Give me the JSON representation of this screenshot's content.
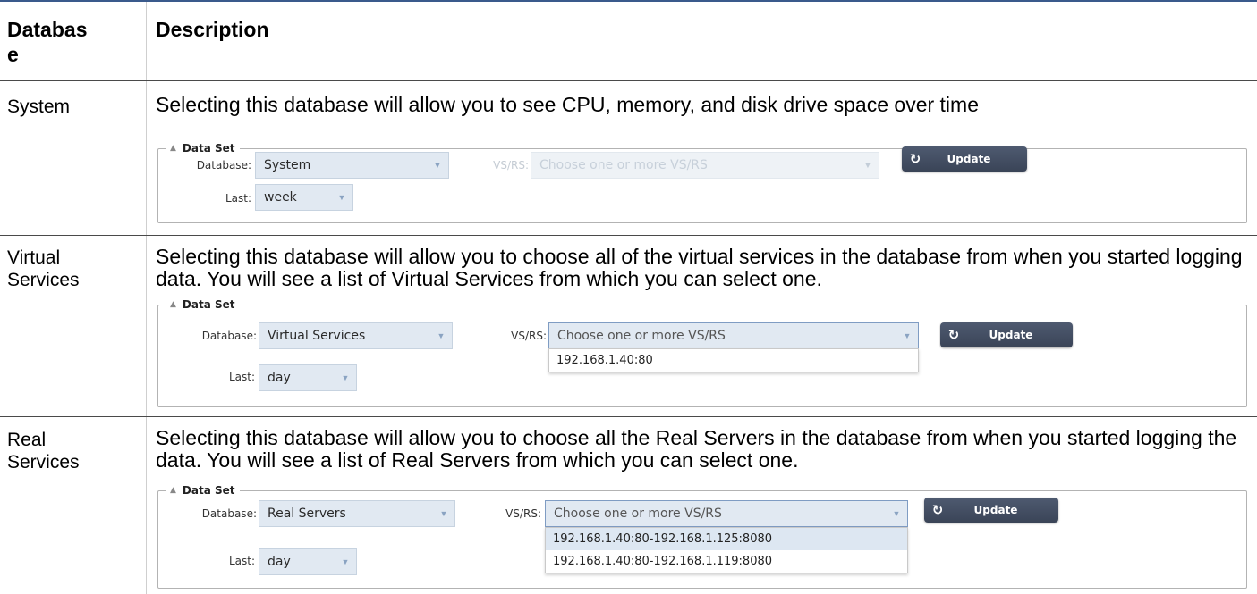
{
  "table": {
    "header_database": "Databas",
    "header_database_wrap": "e",
    "header_description": "Description"
  },
  "rows": [
    {
      "label": "System",
      "description": "Selecting this database will allow you to see CPU, memory, and disk drive space over time",
      "dataset": {
        "legend": "Data Set",
        "database_label": "Database:",
        "database_value": "System",
        "vsrs_label": "VS/RS:",
        "vsrs_placeholder": "Choose one or more VS/RS",
        "vsrs_disabled": true,
        "update_label": "Update",
        "last_label": "Last:",
        "last_value": "week"
      }
    },
    {
      "label": "Virtual Services",
      "description": "Selecting this database will allow you to choose all of the virtual services in the database from when you started logging data. You will see a list of Virtual Services from which you can select one.",
      "dataset": {
        "legend": "Data Set",
        "database_label": "Database:",
        "database_value": "Virtual Services",
        "vsrs_label": "VS/RS:",
        "vsrs_placeholder": "Choose one or more VS/RS",
        "vsrs_disabled": false,
        "update_label": "Update",
        "last_label": "Last:",
        "last_value": "day",
        "vsrs_options": [
          "192.168.1.40:80"
        ]
      }
    },
    {
      "label": "Real Services",
      "description": "Selecting this database will allow you to choose all the Real Servers in the database from when you started logging the data. You will see a list of Real Servers from which you can select one.",
      "dataset": {
        "legend": "Data Set",
        "database_label": "Database:",
        "database_value": "Real Servers",
        "vsrs_label": "VS/RS:",
        "vsrs_placeholder": "Choose one or more VS/RS",
        "vsrs_disabled": false,
        "update_label": "Update",
        "last_label": "Last:",
        "last_value": "day",
        "vsrs_options": [
          "192.168.1.40:80-192.168.1.125:8080",
          "192.168.1.40:80-192.168.1.119:8080"
        ]
      }
    }
  ],
  "icons": {
    "update": "refresh-icon",
    "dropdown": "chevron-down-icon",
    "collapse": "triangle-up-icon"
  },
  "colors": {
    "button": "#434d62",
    "select_bg": "#e1e9f2",
    "highlight": "#dde7f2",
    "top_rule": "#3a5a8c"
  }
}
